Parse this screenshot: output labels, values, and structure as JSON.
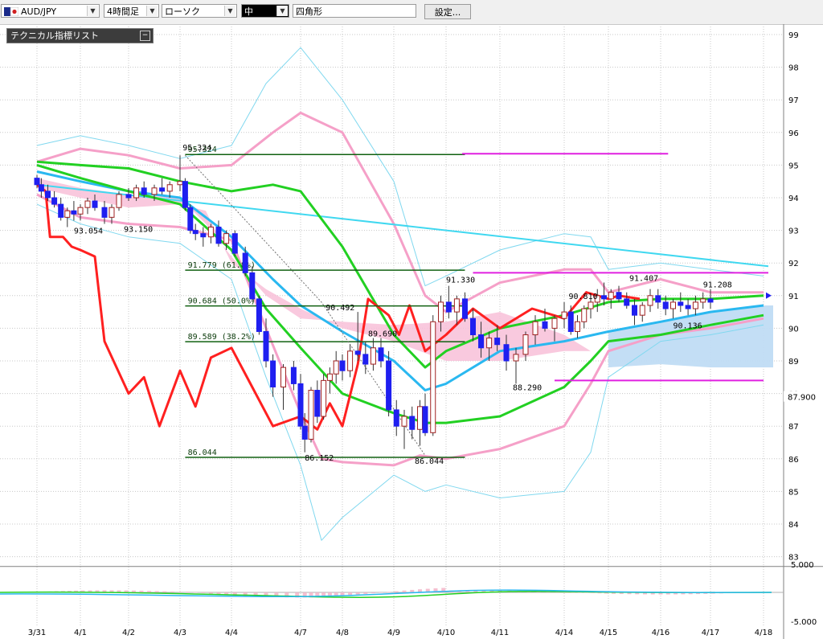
{
  "toolbar": {
    "symbol": "AUD/JPY",
    "timeframe": "4時間足",
    "chart_type": "ローソク",
    "size": "中",
    "shape": "四角形",
    "settings_label": "設定..."
  },
  "technical_panel": {
    "title": "テクニカル指標リスト"
  },
  "colors": {
    "bull_candle": "#ffffff",
    "bear_candle": "#1f1ff0",
    "sma_short": "#ff2020",
    "ma_mid": "#22d022",
    "ma_slow": "#2ab8f0",
    "bollinger_inner": "#f5a0c8",
    "bollinger_outer": "#80d8ef",
    "cloud_bear": "#f8c0d8",
    "cloud_bull": "#c0dcf4",
    "fib_line": "#106010",
    "magenta_line": "#e020e0",
    "trend_line": "#40d8f0"
  },
  "chart_data": {
    "type": "candlestick",
    "title": "",
    "price_axis": [
      "99",
      "98",
      "97",
      "96",
      "95",
      "94",
      "93",
      "92",
      "91",
      "90",
      "89",
      "88",
      "87",
      "86",
      "85",
      "84",
      "83"
    ],
    "current_price_label": "87.900",
    "date_axis": [
      "3/31",
      "4/1",
      "4/2",
      "4/3",
      "4/4",
      "4/7",
      "4/8",
      "4/9",
      "4/10",
      "4/11",
      "4/14",
      "4/15",
      "4/16",
      "4/17",
      "4/18"
    ],
    "price_labels": [
      "95.324",
      "93.054",
      "93.150",
      "86.152",
      "86.044",
      "90.492",
      "89.690",
      "91.330",
      "88.290",
      "90.810",
      "91.407",
      "90.136",
      "91.208"
    ],
    "fib_levels": [
      {
        "label": "95.324",
        "value": 95.324
      },
      {
        "label": "91.779 (61.8%)",
        "value": 91.779
      },
      {
        "label": "90.684 (50.0%)",
        "value": 90.684
      },
      {
        "label": "89.589 (38.2%)",
        "value": 89.589
      },
      {
        "label": "86.044",
        "value": 86.044
      }
    ],
    "osc_axis": [
      "5.000",
      "-5.000"
    ]
  }
}
